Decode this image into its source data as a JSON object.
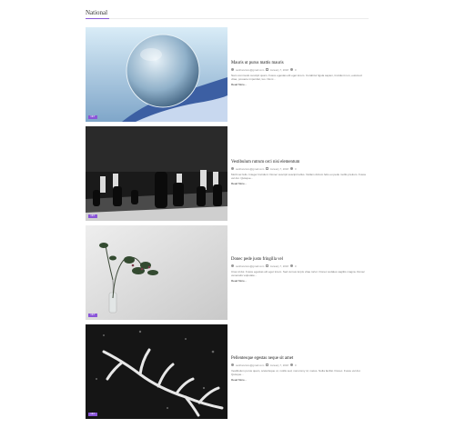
{
  "section": {
    "title": "National"
  },
  "posts": [
    {
      "title": "Mauris ut purus mattis mauris",
      "author": "sanfrancisco@gmail.com",
      "date": "January 7, 2018",
      "comments": "0",
      "excerpt": "Nam commodo suscipit quam. Fusce egestas elit eget lorem. Curabitur ligula sapien, tincidunt non, euismod vitae, posuere imperdiet, leo. Nunc...",
      "read_more": "Read More...",
      "badge": "NFT"
    },
    {
      "title": "Vestibulum rutrum orci nisi elementum",
      "author": "sanfrancisco@gmail.com",
      "date": "January 7, 2018",
      "comments": "0",
      "excerpt": "Morbi ac felis. Integer tincidunt. Donec suscipit suscipit tellus. Nullam dictum felis eu pede mollis pretium. Fusce vel dui. Quisque...",
      "read_more": "Read More...",
      "badge": "NFT"
    },
    {
      "title": "Donec pede justo fringilla vel",
      "author": "sanfrancisco@gmail.com",
      "date": "January 7, 2018",
      "comments": "0",
      "excerpt": "Cras id dui. Fusce egestas elit eget lorem. Sed cursus turpis vitae tortor. Donec sodales sagittis magna. Donec venenatis vulputate...",
      "read_more": "Read More...",
      "badge": "NFT"
    },
    {
      "title": "Pellentesque egestas neque sit amet",
      "author": "sanfrancisco@gmail.com",
      "date": "January 7, 2018",
      "comments": "0",
      "excerpt": "Vestibulum purus quam, scelerisque ut, mollis sed, nonummy id, metus. Nulla facilisi. Donec. Fusce vel dui. Quisque...",
      "read_more": "Read More...",
      "badge": "NFT"
    }
  ]
}
